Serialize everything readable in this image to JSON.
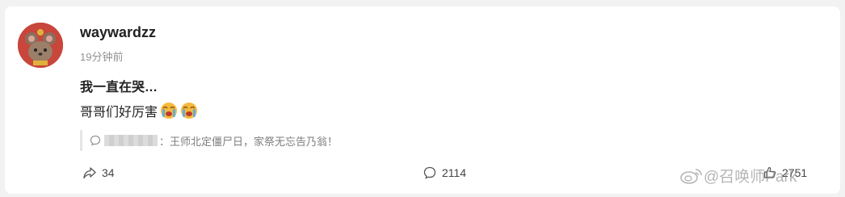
{
  "post": {
    "username": "waywardzz",
    "timestamp": "19分钟前",
    "title": "我一直在哭…",
    "body": "哥哥们好厉害",
    "quote_text": "：王师北定僵尸日，家祭无忘告乃翁！"
  },
  "actions": {
    "share_count": "34",
    "comment_count": "2114",
    "like_count": "2751"
  },
  "watermark": {
    "text": "@召唤师Park"
  },
  "colors": {
    "avatar_bg": "#c8463b",
    "muted_text": "#939393"
  }
}
